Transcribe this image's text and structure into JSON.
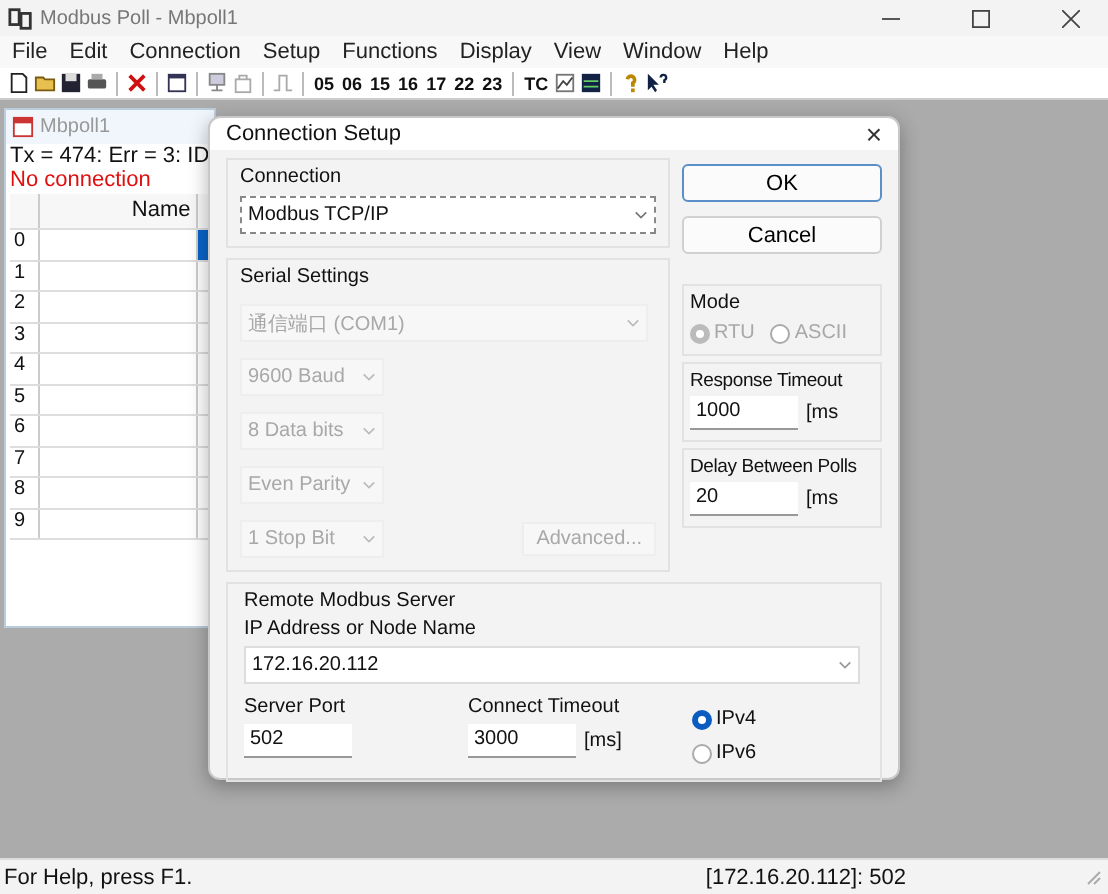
{
  "window": {
    "title": "Modbus Poll - Mbpoll1"
  },
  "menu": [
    "File",
    "Edit",
    "Connection",
    "Setup",
    "Functions",
    "Display",
    "View",
    "Window",
    "Help"
  ],
  "toolbar": {
    "function_codes": [
      "05",
      "06",
      "15",
      "16",
      "17",
      "22",
      "23"
    ],
    "tc": "TC"
  },
  "child_window": {
    "title": "Mbpoll1",
    "stats": "Tx = 474: Err = 3: ID",
    "error": "No connection",
    "column": "Name",
    "rows": [
      {
        "index": "0",
        "selected": true
      },
      {
        "index": "1",
        "selected": false
      },
      {
        "index": "2",
        "selected": false
      },
      {
        "index": "3",
        "selected": false
      },
      {
        "index": "4",
        "selected": false
      },
      {
        "index": "5",
        "selected": false
      },
      {
        "index": "6",
        "selected": false
      },
      {
        "index": "7",
        "selected": false
      },
      {
        "index": "8",
        "selected": false
      },
      {
        "index": "9",
        "selected": false
      }
    ]
  },
  "dialog": {
    "title": "Connection Setup",
    "close": "×",
    "connection": {
      "label": "Connection",
      "value": "Modbus TCP/IP"
    },
    "buttons": [
      "OK",
      "Cancel"
    ],
    "serial": {
      "label": "Serial Settings",
      "disabled": true,
      "port": "通信端口 (COM1)",
      "baud": "9600 Baud",
      "data_bits": "8 Data bits",
      "parity": "Even Parity",
      "stop_bits": "1 Stop Bit",
      "advanced": "Advanced..."
    },
    "mode": {
      "label": "Mode",
      "disabled": true,
      "options": [
        {
          "label": "RTU",
          "selected": true
        },
        {
          "label": "ASCII",
          "selected": false
        }
      ]
    },
    "response_timeout": {
      "label": "Response Timeout",
      "value": "1000",
      "unit": "[ms"
    },
    "delay": {
      "label": "Delay Between Polls",
      "value": "20",
      "unit": "[ms"
    },
    "remote": {
      "label": "Remote Modbus Server",
      "ip_label": "IP Address or Node Name",
      "ip_value": "172.16.20.112",
      "port_label": "Server Port",
      "port_value": "502",
      "timeout_label": "Connect Timeout",
      "timeout_value": "3000",
      "timeout_unit": "[ms]",
      "ip_versions": [
        {
          "label": "IPv4",
          "selected": true
        },
        {
          "label": "IPv6",
          "selected": false
        }
      ]
    }
  },
  "status_bar": {
    "help": "For Help, press F1.",
    "connection": "[172.16.20.112]: 502"
  }
}
